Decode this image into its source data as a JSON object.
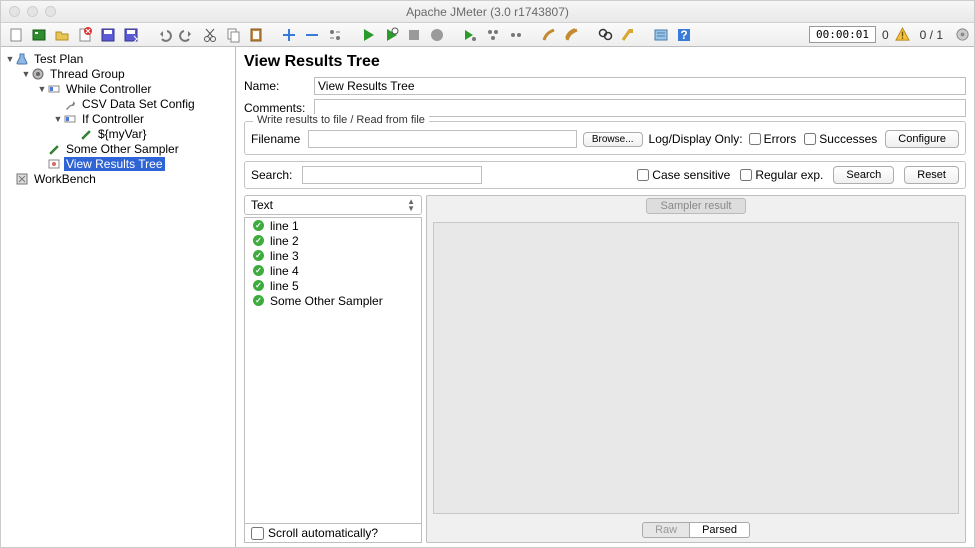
{
  "window": {
    "title": "Apache JMeter (3.0 r1743807)"
  },
  "status": {
    "time": "00:00:01",
    "warnings": "0",
    "threads": "0 / 1"
  },
  "tree": {
    "testplan": "Test Plan",
    "threadgroup": "Thread Group",
    "whilectrl": "While Controller",
    "csv": "CSV Data Set Config",
    "ifctrl": "If Controller",
    "myvar": "${myVar}",
    "sampler": "Some Other Sampler",
    "vrt": "View Results Tree",
    "workbench": "WorkBench"
  },
  "panel": {
    "title": "View Results Tree",
    "name_label": "Name:",
    "name_value": "View Results Tree",
    "comments_label": "Comments:",
    "group_legend": "Write results to file / Read from file",
    "filename_label": "Filename",
    "browse": "Browse...",
    "logdisplay": "Log/Display Only:",
    "errors": "Errors",
    "successes": "Successes",
    "configure": "Configure",
    "search_label": "Search:",
    "case_sens": "Case sensitive",
    "regex": "Regular exp.",
    "search_btn": "Search",
    "reset_btn": "Reset",
    "renderer": "Text",
    "results": [
      "line 1",
      "line 2",
      "line 3",
      "line 4",
      "line 5",
      "Some Other Sampler"
    ],
    "scroll_auto": "Scroll automatically?",
    "tab_sampler": "Sampler result",
    "tab_raw": "Raw",
    "tab_parsed": "Parsed"
  }
}
